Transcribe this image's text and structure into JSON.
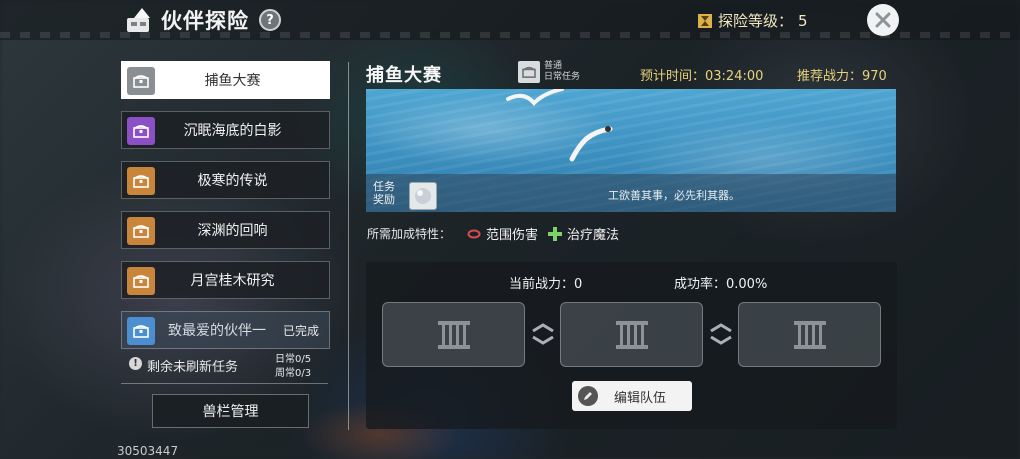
{
  "header": {
    "title": "伙伴探险",
    "help": "?",
    "level_label": "探险等级：",
    "level_value": "5"
  },
  "tasks": [
    {
      "label": "捕鱼大赛",
      "active": true,
      "icon_color": "#8a8f93"
    },
    {
      "label": "沉眠海底的白影",
      "active": false,
      "icon_color": "#8b4fc6"
    },
    {
      "label": "极寒的传说",
      "active": false,
      "icon_color": "#c9863a"
    },
    {
      "label": "深渊的回响",
      "active": false,
      "icon_color": "#c9863a"
    },
    {
      "label": "月宫桂木研究",
      "active": false,
      "icon_color": "#c9863a"
    },
    {
      "label": "致最爱的伙伴一",
      "done_tag": "已完成",
      "icon_color": "#4b8fd0"
    }
  ],
  "refresh": {
    "text": "剩余未刷新任务",
    "daily": "日常0/5",
    "weekly": "周常0/3"
  },
  "manage_button": "兽栏管理",
  "uid": "30503447",
  "detail": {
    "title": "捕鱼大赛",
    "type_line1": "普通",
    "type_line2": "日常任务",
    "est_time": "预计时间：03:24:00",
    "rec_power": "推荐战力：970",
    "reward_label_1": "任务",
    "reward_label_2": "奖励",
    "quote": "工欲善其事，必先利其器。",
    "traits_label": "所需加成特性：",
    "traits": [
      "范围伤害",
      "治疗魔法"
    ],
    "current_power": "当前战力：0",
    "success_rate": "成功率：0.00%",
    "edit_button": "编辑队伍"
  },
  "colors": {
    "accent_gold": "#e9d27c",
    "trait_red": "#d94b4b",
    "trait_green": "#7bd36a"
  }
}
